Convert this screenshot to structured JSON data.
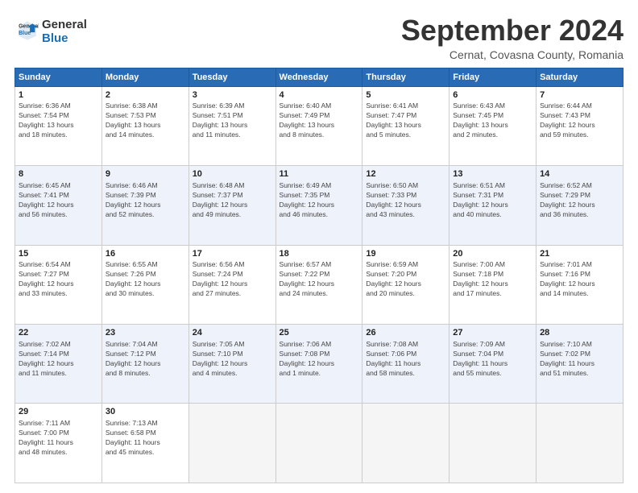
{
  "logo": {
    "line1": "General",
    "line2": "Blue"
  },
  "title": "September 2024",
  "subtitle": "Cernat, Covasna County, Romania",
  "days_header": [
    "Sunday",
    "Monday",
    "Tuesday",
    "Wednesday",
    "Thursday",
    "Friday",
    "Saturday"
  ],
  "weeks": [
    [
      {
        "day": "1",
        "info": "Sunrise: 6:36 AM\nSunset: 7:54 PM\nDaylight: 13 hours\nand 18 minutes."
      },
      {
        "day": "2",
        "info": "Sunrise: 6:38 AM\nSunset: 7:53 PM\nDaylight: 13 hours\nand 14 minutes."
      },
      {
        "day": "3",
        "info": "Sunrise: 6:39 AM\nSunset: 7:51 PM\nDaylight: 13 hours\nand 11 minutes."
      },
      {
        "day": "4",
        "info": "Sunrise: 6:40 AM\nSunset: 7:49 PM\nDaylight: 13 hours\nand 8 minutes."
      },
      {
        "day": "5",
        "info": "Sunrise: 6:41 AM\nSunset: 7:47 PM\nDaylight: 13 hours\nand 5 minutes."
      },
      {
        "day": "6",
        "info": "Sunrise: 6:43 AM\nSunset: 7:45 PM\nDaylight: 13 hours\nand 2 minutes."
      },
      {
        "day": "7",
        "info": "Sunrise: 6:44 AM\nSunset: 7:43 PM\nDaylight: 12 hours\nand 59 minutes."
      }
    ],
    [
      {
        "day": "8",
        "info": "Sunrise: 6:45 AM\nSunset: 7:41 PM\nDaylight: 12 hours\nand 56 minutes."
      },
      {
        "day": "9",
        "info": "Sunrise: 6:46 AM\nSunset: 7:39 PM\nDaylight: 12 hours\nand 52 minutes."
      },
      {
        "day": "10",
        "info": "Sunrise: 6:48 AM\nSunset: 7:37 PM\nDaylight: 12 hours\nand 49 minutes."
      },
      {
        "day": "11",
        "info": "Sunrise: 6:49 AM\nSunset: 7:35 PM\nDaylight: 12 hours\nand 46 minutes."
      },
      {
        "day": "12",
        "info": "Sunrise: 6:50 AM\nSunset: 7:33 PM\nDaylight: 12 hours\nand 43 minutes."
      },
      {
        "day": "13",
        "info": "Sunrise: 6:51 AM\nSunset: 7:31 PM\nDaylight: 12 hours\nand 40 minutes."
      },
      {
        "day": "14",
        "info": "Sunrise: 6:52 AM\nSunset: 7:29 PM\nDaylight: 12 hours\nand 36 minutes."
      }
    ],
    [
      {
        "day": "15",
        "info": "Sunrise: 6:54 AM\nSunset: 7:27 PM\nDaylight: 12 hours\nand 33 minutes."
      },
      {
        "day": "16",
        "info": "Sunrise: 6:55 AM\nSunset: 7:26 PM\nDaylight: 12 hours\nand 30 minutes."
      },
      {
        "day": "17",
        "info": "Sunrise: 6:56 AM\nSunset: 7:24 PM\nDaylight: 12 hours\nand 27 minutes."
      },
      {
        "day": "18",
        "info": "Sunrise: 6:57 AM\nSunset: 7:22 PM\nDaylight: 12 hours\nand 24 minutes."
      },
      {
        "day": "19",
        "info": "Sunrise: 6:59 AM\nSunset: 7:20 PM\nDaylight: 12 hours\nand 20 minutes."
      },
      {
        "day": "20",
        "info": "Sunrise: 7:00 AM\nSunset: 7:18 PM\nDaylight: 12 hours\nand 17 minutes."
      },
      {
        "day": "21",
        "info": "Sunrise: 7:01 AM\nSunset: 7:16 PM\nDaylight: 12 hours\nand 14 minutes."
      }
    ],
    [
      {
        "day": "22",
        "info": "Sunrise: 7:02 AM\nSunset: 7:14 PM\nDaylight: 12 hours\nand 11 minutes."
      },
      {
        "day": "23",
        "info": "Sunrise: 7:04 AM\nSunset: 7:12 PM\nDaylight: 12 hours\nand 8 minutes."
      },
      {
        "day": "24",
        "info": "Sunrise: 7:05 AM\nSunset: 7:10 PM\nDaylight: 12 hours\nand 4 minutes."
      },
      {
        "day": "25",
        "info": "Sunrise: 7:06 AM\nSunset: 7:08 PM\nDaylight: 12 hours\nand 1 minute."
      },
      {
        "day": "26",
        "info": "Sunrise: 7:08 AM\nSunset: 7:06 PM\nDaylight: 11 hours\nand 58 minutes."
      },
      {
        "day": "27",
        "info": "Sunrise: 7:09 AM\nSunset: 7:04 PM\nDaylight: 11 hours\nand 55 minutes."
      },
      {
        "day": "28",
        "info": "Sunrise: 7:10 AM\nSunset: 7:02 PM\nDaylight: 11 hours\nand 51 minutes."
      }
    ],
    [
      {
        "day": "29",
        "info": "Sunrise: 7:11 AM\nSunset: 7:00 PM\nDaylight: 11 hours\nand 48 minutes."
      },
      {
        "day": "30",
        "info": "Sunrise: 7:13 AM\nSunset: 6:58 PM\nDaylight: 11 hours\nand 45 minutes."
      },
      {
        "day": "",
        "info": ""
      },
      {
        "day": "",
        "info": ""
      },
      {
        "day": "",
        "info": ""
      },
      {
        "day": "",
        "info": ""
      },
      {
        "day": "",
        "info": ""
      }
    ]
  ]
}
